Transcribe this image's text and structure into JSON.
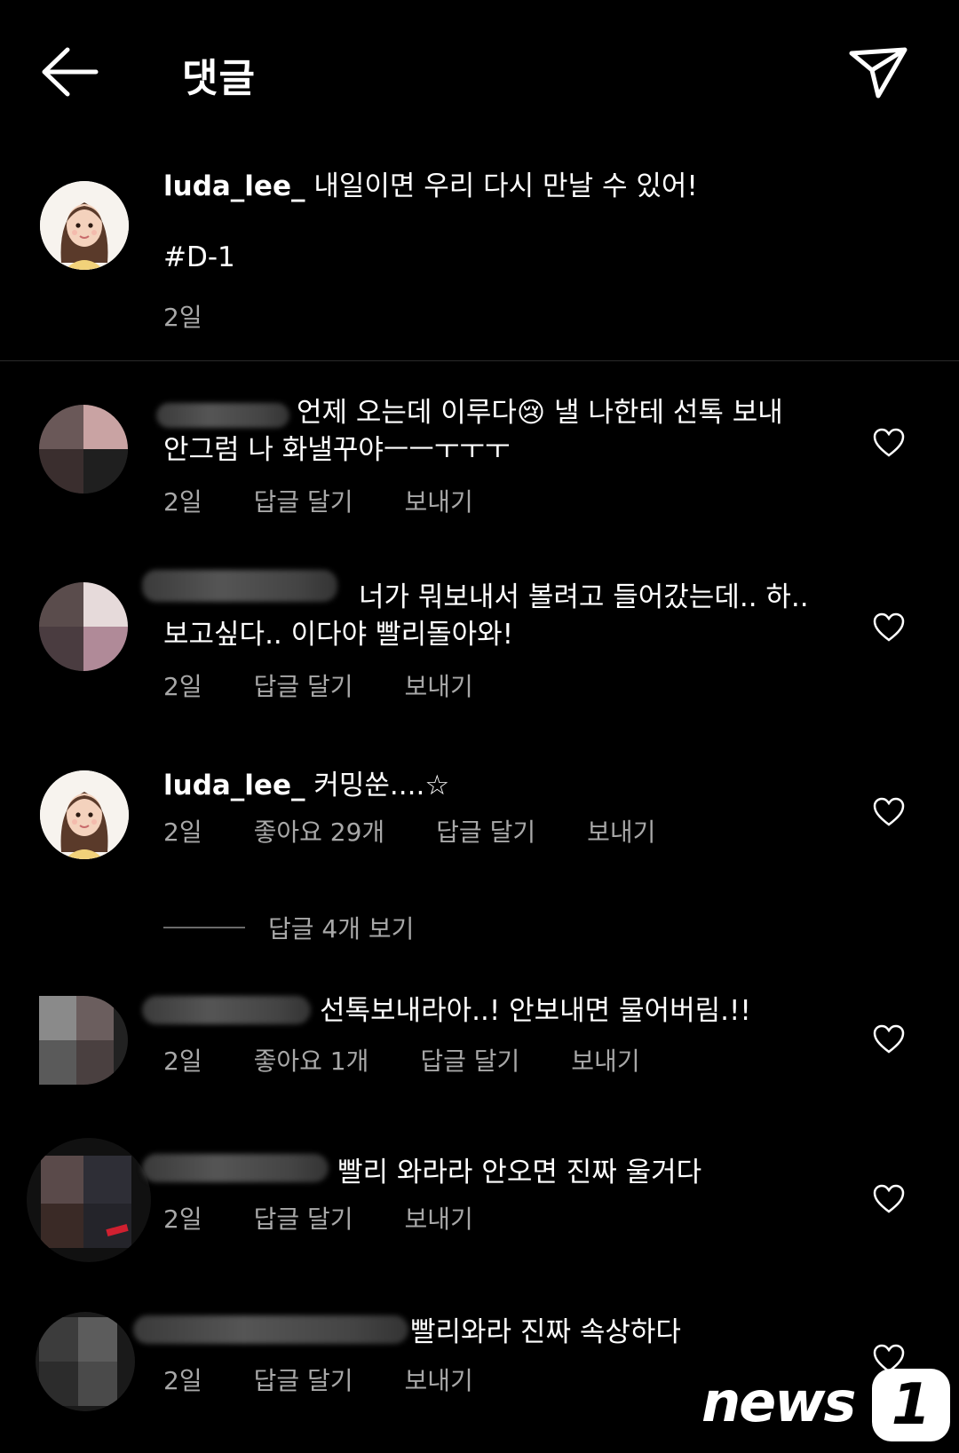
{
  "header": {
    "title": "댓글",
    "back_icon": "arrow-left-icon",
    "share_icon": "paper-plane-icon"
  },
  "caption": {
    "username": "luda_lee_",
    "text": " 내일이면 우리 다시 만날 수 있어!",
    "hashtag": "#D-1",
    "time": "2일"
  },
  "comments": [
    {
      "text_l1": "언제 오는데 이루다😢 낼 나한테 선톡 보내",
      "text_l2": "안그럼 나 화낼꾸야ㅡㅡㅜㅜㅜ",
      "time": "2일",
      "reply": "답글 달기",
      "send": "보내기"
    },
    {
      "text_l1": "너가 뭐보내서 볼려고 들어갔는데.. 하..",
      "text_l2": "보고싶다.. 이다야 빨리돌아와!",
      "time": "2일",
      "reply": "답글 달기",
      "send": "보내기"
    },
    {
      "username": "luda_lee_",
      "text": " 커밍쑨....☆",
      "time": "2일",
      "likes": "좋아요 29개",
      "reply": "답글 달기",
      "send": "보내기",
      "view_replies": "답글 4개 보기"
    },
    {
      "text": "선톡보내라아..! 안보내면 물어버림.!!",
      "time": "2일",
      "likes": "좋아요 1개",
      "reply": "답글 달기",
      "send": "보내기"
    },
    {
      "text": "빨리 와라라 안오면 진짜 울거다",
      "time": "2일",
      "reply": "답글 달기",
      "send": "보내기"
    },
    {
      "text": "빨리와라 진짜 속상하다",
      "time": "2일",
      "reply": "답글 달기",
      "send": "보내기"
    }
  ],
  "watermark": {
    "text": "news",
    "mark": "1"
  },
  "icons": {
    "like": "heart-outline-icon"
  },
  "colors": {
    "background": "#000000",
    "text": "#ffffff",
    "muted": "#a8a8a8"
  }
}
